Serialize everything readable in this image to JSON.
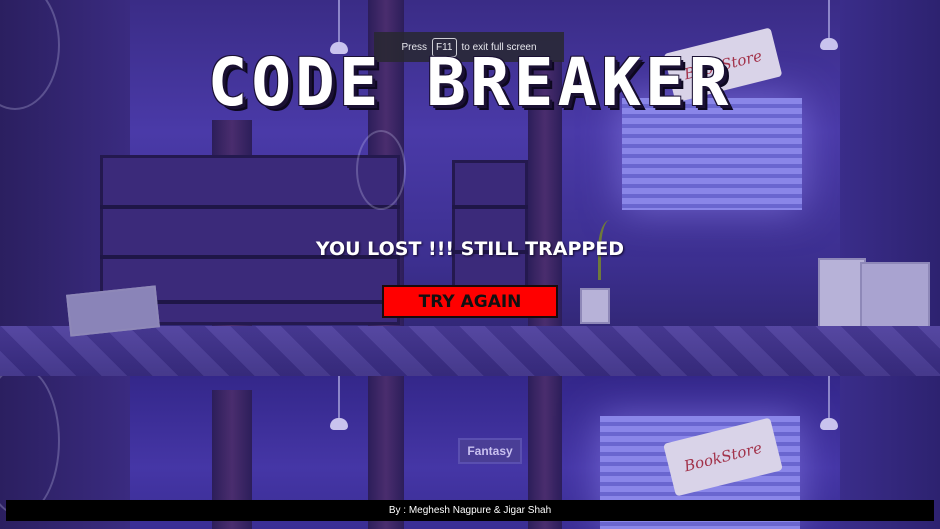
{
  "fullscreen_notice": {
    "prefix": "Press",
    "key": "F11",
    "suffix": "to exit full screen"
  },
  "game": {
    "title": "CODE BREAKER",
    "status_message": "YOU LOST !!! STILL TRAPPED",
    "try_again_label": "TRY AGAIN"
  },
  "scene": {
    "sign_top": "BookStore",
    "sign_bottom": "BookStore",
    "shelf_label": "Fantasy"
  },
  "footer": {
    "credits": "By : Meghesh Nagpure & Jigar Shah"
  },
  "colors": {
    "button_background": "#ff0000",
    "title_text": "#ffffff",
    "footer_background": "#000000"
  }
}
